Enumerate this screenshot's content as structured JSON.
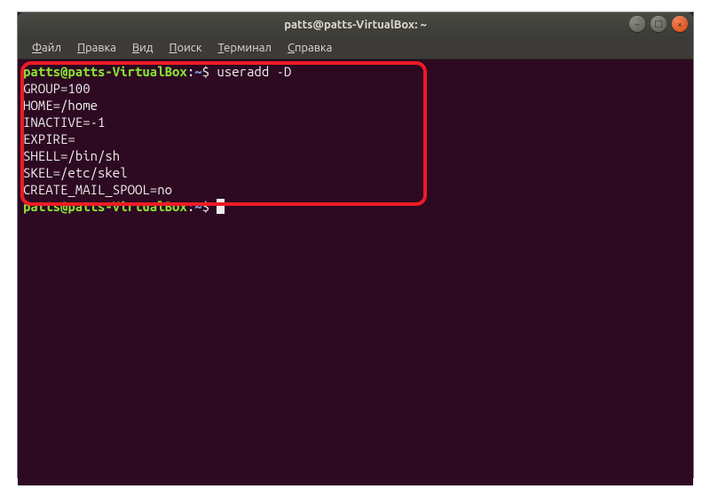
{
  "titlebar": {
    "title": "patts@patts-VirtualBox: ~"
  },
  "window_controls": {
    "minimize": "–",
    "maximize": "□",
    "close": "×"
  },
  "menubar": {
    "items": [
      "Файл",
      "Правка",
      "Вид",
      "Поиск",
      "Терминал",
      "Справка"
    ]
  },
  "terminal": {
    "prompt1": {
      "user_host": "patts@patts-VirtualBox",
      "colon": ":",
      "path": "~",
      "dollar": "$",
      "command": " useradd -D"
    },
    "output": [
      "GROUP=100",
      "HOME=/home",
      "INACTIVE=-1",
      "EXPIRE=",
      "SHELL=/bin/sh",
      "SKEL=/etc/skel",
      "CREATE_MAIL_SPOOL=no"
    ],
    "prompt2": {
      "user_host": "patts@patts-VirtualBox",
      "colon": ":",
      "path": "~",
      "dollar": "$",
      "command": ""
    }
  }
}
